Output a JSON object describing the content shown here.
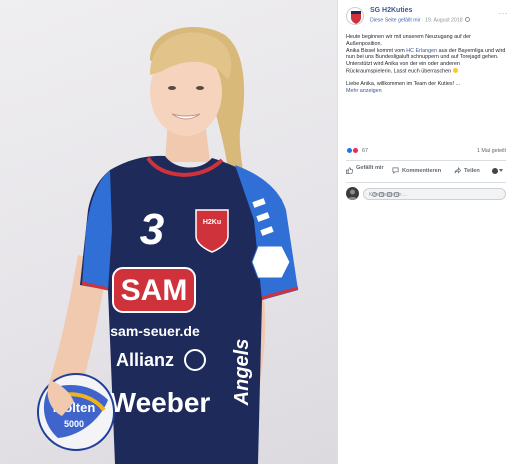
{
  "post": {
    "page_name": "SG H2Kuties",
    "liked_text": "Diese Seite gefällt mir",
    "date": "19. August 2018",
    "more": "···",
    "text": {
      "line1": "Heute beginnen wir mit unserem Neuzugang auf der Außenposition.",
      "line2_pre": "Anika Bissel kommt vom ",
      "line2_link": "HC Erlangen",
      "line2_post": " aus der Bayernliga und wird nun bei uns Bundesligaluft schnuppern und auf Torejagd gehen.",
      "line3": "Unterstützt wird Anika von der ein oder anderen Rückraumspielerin. Lasst euch überraschen",
      "line4": "Liebe Anika, willkommen im Team der Kuties! ...",
      "more_link": "Mehr anzeigen"
    },
    "reactions_count": "67",
    "shared": "1 Mal geteilt",
    "actions": {
      "like": "Gefällt mir",
      "comment": "Kommentieren",
      "share": "Teilen"
    },
    "comment_placeholder": "Kommentieren ..."
  },
  "photo": {
    "jersey_number": "3",
    "badge": "H2Ku",
    "sponsor_main": "SAM",
    "sponsor_url": "sam-seuer.de",
    "sponsor_allianz": "Allianz",
    "sponsor_weber": "Weeber",
    "sponsor_angels": "Angels",
    "ball_brand": "molten",
    "ball_size": "5000"
  },
  "colors": {
    "link": "#385898",
    "jersey_navy": "#1e2a5a",
    "jersey_blue": "#2f6fd6",
    "jersey_red": "#d0323b",
    "like_blue": "#1877f2"
  }
}
